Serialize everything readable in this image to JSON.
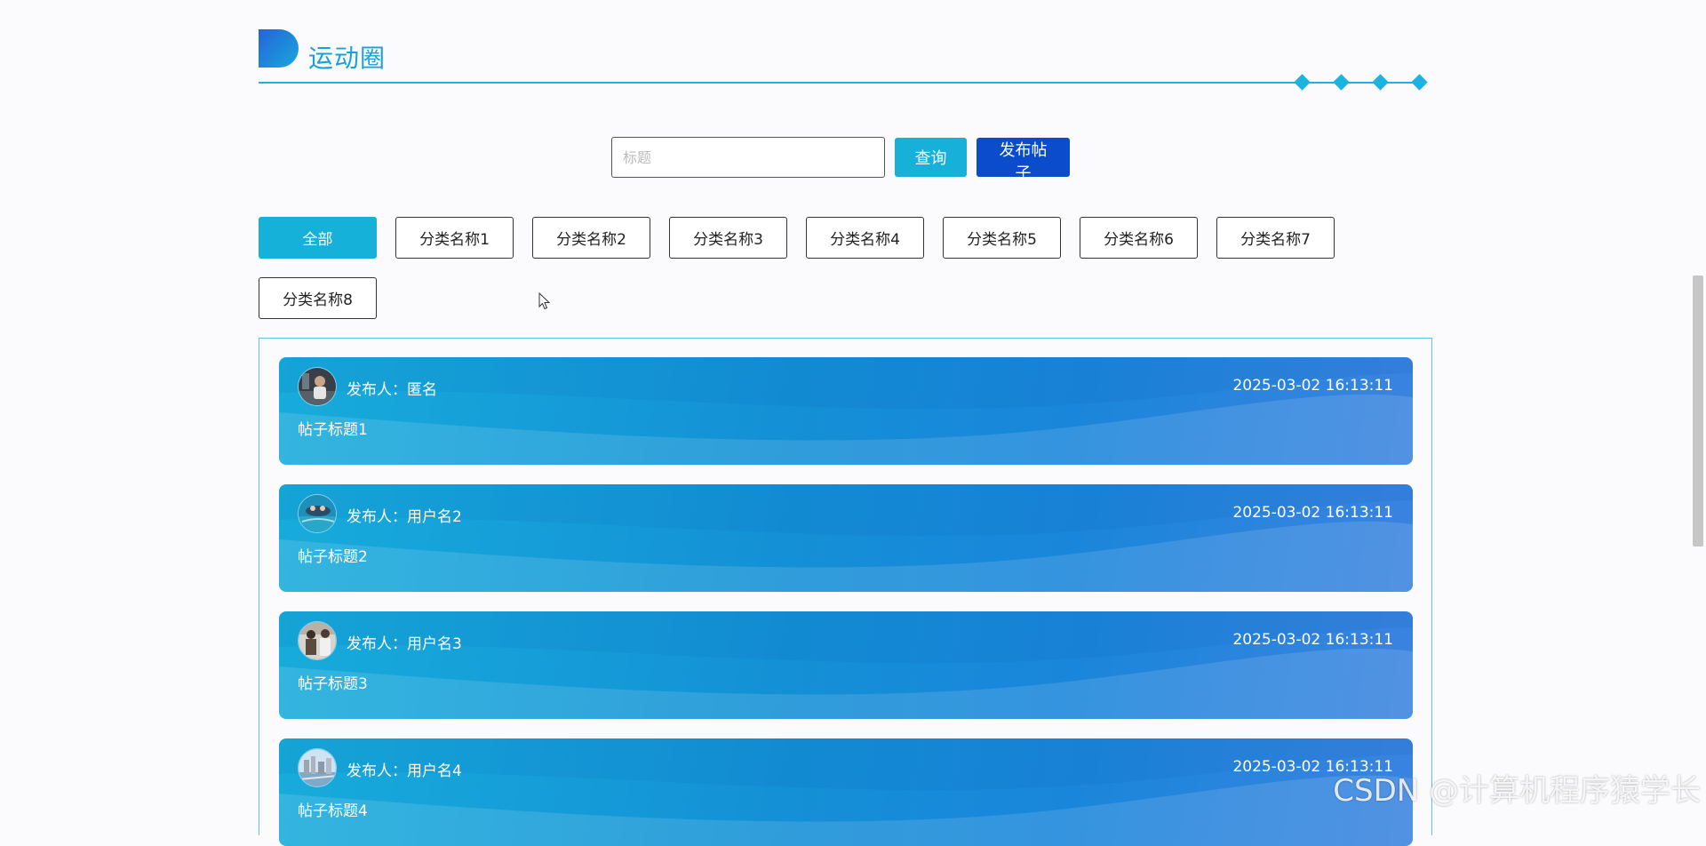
{
  "section": {
    "title": "运动圈"
  },
  "search": {
    "placeholder": "标题",
    "value": "",
    "query_label": "查询",
    "publish_label": "发布帖子"
  },
  "categories": [
    {
      "label": "全部",
      "active": true
    },
    {
      "label": "分类名称1",
      "active": false
    },
    {
      "label": "分类名称2",
      "active": false
    },
    {
      "label": "分类名称3",
      "active": false
    },
    {
      "label": "分类名称4",
      "active": false
    },
    {
      "label": "分类名称5",
      "active": false
    },
    {
      "label": "分类名称6",
      "active": false
    },
    {
      "label": "分类名称7",
      "active": false
    },
    {
      "label": "分类名称8",
      "active": false
    }
  ],
  "posts": [
    {
      "author": "发布人：匿名",
      "time": "2025-03-02 16:13:11",
      "title": "帖子标题1",
      "avatar": "avatar-photo-person"
    },
    {
      "author": "发布人：用户名2",
      "time": "2025-03-02 16:13:11",
      "title": "帖子标题2",
      "avatar": "avatar-photo-water"
    },
    {
      "author": "发布人：用户名3",
      "time": "2025-03-02 16:13:11",
      "title": "帖子标题3",
      "avatar": "avatar-photo-people"
    },
    {
      "author": "发布人：用户名4",
      "time": "2025-03-02 16:13:11",
      "title": "帖子标题4",
      "avatar": "avatar-photo-city"
    }
  ],
  "watermark": "CSDN @计算机程序猿学长",
  "colors": {
    "accent": "#15b1d9",
    "publish": "#0a4ccb",
    "card_start": "#17acdb",
    "card_end": "#3b83df"
  }
}
